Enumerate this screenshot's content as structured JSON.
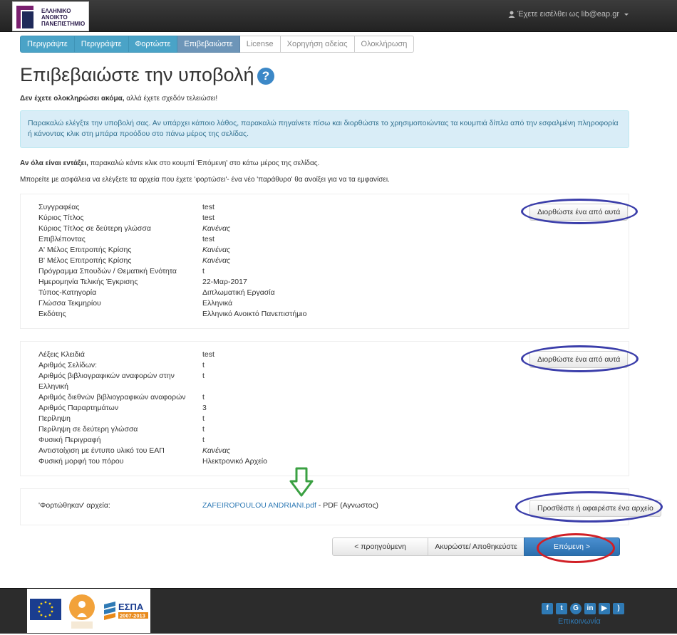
{
  "header": {
    "logo_text": "ΕΛΛΗΝΙΚΟ\nΑΝΟΙΚΤΟ\nΠΑΝΕΠΙΣΤΗΜΙΟ",
    "user_text": "Έχετε εισέλθει ως lib@eap.gr"
  },
  "steps": [
    "Περιγράψτε",
    "Περιγράψτε",
    "Φορτώστε",
    "Επιβεβαιώστε",
    "License",
    "Χορηγήση αδείας",
    "Ολοκλήρωση"
  ],
  "page": {
    "title": "Επιβεβαιώστε την υποβολή",
    "almost_bold": "Δεν έχετε ολοκληρώσει ακόμα,",
    "almost_rest": " αλλά έχετε σχεδόν τελειώσει!",
    "alert": "Παρακαλώ ελέγξτε την υποβολή σας. Αν υπάρχει κάποιο λάθος, παρακαλώ πηγαίνετε πίσω και διορθώστε το χρησιμοποιώντας τα κουμπιά δίπλα από την εσφαλμένη πληροφορία ή κάνοντας κλικ στη μπάρα προόδου στο πάνω μέρος της σελίδας.",
    "ok_bold": "Αν όλα είναι εντάξει,",
    "ok_rest": " παρακαλώ κάντε κλικ στο κουμπί 'Επόμενη' στο κάτω μέρος της σελίδας.",
    "files_note": "Μπορείτε με ασφάλεια να ελέγξετε τα αρχεία που έχετε 'φορτώσει'- ένα νέο 'παράθυρο' θα ανοίξει για να τα εμφανίσει."
  },
  "section1": {
    "edit_label": "Διορθώστε ένα από αυτά",
    "rows": [
      {
        "label": "Συγγραφέας",
        "value": "test",
        "em": false
      },
      {
        "label": "Κύριος Τίτλος",
        "value": "test",
        "em": false
      },
      {
        "label": "Κύριος Τίτλος σε δεύτερη γλώσσα",
        "value": "Κανένας",
        "em": true
      },
      {
        "label": "Επιβλέποντας",
        "value": "test",
        "em": false
      },
      {
        "label": "Α' Μέλος Επιτροπής Κρίσης",
        "value": "Κανένας",
        "em": true
      },
      {
        "label": "Β' Μέλος Επιτροπής Κρίσης",
        "value": "Κανένας",
        "em": true
      },
      {
        "label": "Πρόγραμμα Σπουδών / Θεματική Ενότητα",
        "value": "t",
        "em": false
      },
      {
        "label": "Ημερομηνία Τελικής Έγκρισης",
        "value": "22-Μαρ-2017",
        "em": false
      },
      {
        "label": "Τύπος-Κατηγορία",
        "value": "Διπλωματική Εργασία",
        "em": false
      },
      {
        "label": "Γλώσσα Τεκμηρίου",
        "value": "Ελληνικά",
        "em": false
      },
      {
        "label": "Εκδότης",
        "value": "Ελληνικό Ανοικτό Πανεπιστήμιο",
        "em": false
      }
    ]
  },
  "section2": {
    "edit_label": "Διορθώστε ένα από αυτά",
    "rows": [
      {
        "label": "Λέξεις Κλειδιά",
        "value": "test",
        "em": false,
        "lines": 1
      },
      {
        "label": "Αριθμός Σελίδων:",
        "value": "t",
        "em": false,
        "lines": 1
      },
      {
        "label": "Αριθμός βιβλιογραφικών αναφορών στην Ελληνική",
        "value": "t",
        "em": false,
        "lines": 2
      },
      {
        "label": "Αριθμός διεθνών βιβλιογραφικών αναφορών",
        "value": "t",
        "em": false,
        "lines": 1
      },
      {
        "label": "Αριθμός Παραρτημάτων",
        "value": "3",
        "em": false,
        "lines": 1
      },
      {
        "label": "Περίληψη",
        "value": "t",
        "em": false,
        "lines": 1
      },
      {
        "label": "Περίληψη σε δεύτερη γλώσσα",
        "value": "t",
        "em": false,
        "lines": 1
      },
      {
        "label": "Φυσική Περιγραφή",
        "value": "t",
        "em": false,
        "lines": 1
      },
      {
        "label": "Αντιστοίχιση με έντυπο υλικό του ΕΑΠ",
        "value": "Κανένας",
        "em": true,
        "lines": 1
      },
      {
        "label": "Φυσική μορφή του πόρου",
        "value": "Ηλεκτρονικό Αρχείο",
        "em": false,
        "lines": 1
      }
    ]
  },
  "section3": {
    "label": "'Φορτώθηκαν' αρχεία:",
    "file_name": "ZAFEIROPOULOU ANDRIANI.pdf",
    "file_info": " - PDF (Αγνωστος)",
    "button": "Προσθέστε ή αφαιρέστε ένα αρχείο"
  },
  "nav": {
    "prev": "< προηγούμενη",
    "cancel": "Ακυρώστε/ Αποθηκεύστε",
    "next": "Επόμενη >"
  },
  "footer": {
    "contact": "Επικοινωνία",
    "espa_text": "ΕΣΠΑ",
    "espa_years": "2007-2013",
    "social_icons": [
      "facebook-icon",
      "twitter-icon",
      "google-plus-icon",
      "linkedin-icon",
      "youtube-icon",
      "rss-icon"
    ]
  }
}
